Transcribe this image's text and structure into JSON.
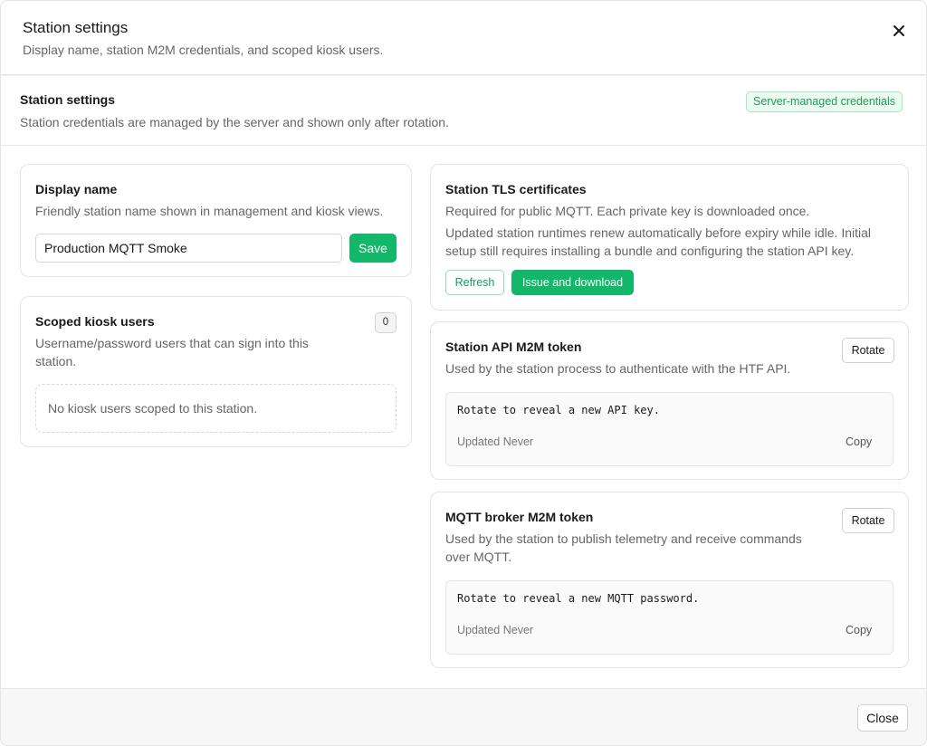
{
  "dialog": {
    "title": "Station settings",
    "subtitle": "Display name, station M2M credentials, and scoped kiosk users.",
    "close_icon": "close-icon"
  },
  "section": {
    "title": "Station settings",
    "subtitle": "Station credentials are managed by the server and shown only after rotation.",
    "badge": "Server-managed credentials"
  },
  "display_name": {
    "title": "Display name",
    "description": "Friendly station name shown in management and kiosk views.",
    "value": "Production MQTT Smoke",
    "save_label": "Save"
  },
  "kiosk_users": {
    "title": "Scoped kiosk users",
    "count": "0",
    "description_line1": "Username/password users that can sign into this",
    "description_line2": "station.",
    "empty": "No kiosk users scoped to this station."
  },
  "tls": {
    "title": "Station TLS certificates",
    "line1": "Required for public MQTT. Each private key is downloaded once.",
    "line2": "Updated station runtimes renew automatically before expiry while idle. Initial",
    "line3": "setup still requires installing a bundle and configuring the station API key.",
    "refresh_label": "Refresh",
    "issue_label": "Issue and download"
  },
  "api_token": {
    "title": "Station API M2M token",
    "description": "Used by the station process to authenticate with the HTF API.",
    "rotate_label": "Rotate",
    "placeholder": "Rotate to reveal a new API key.",
    "updated": "Updated Never",
    "copy_label": "Copy"
  },
  "mqtt_token": {
    "title": "MQTT broker M2M token",
    "description_line1": "Used by the station to publish telemetry and receive commands",
    "description_line2": "over MQTT.",
    "rotate_label": "Rotate",
    "placeholder": "Rotate to reveal a new MQTT password.",
    "updated": "Updated Never",
    "copy_label": "Copy"
  },
  "footer": {
    "close_label": "Close"
  },
  "colors": {
    "accent": "#12b76a",
    "badge_bg": "#ecfbf2",
    "badge_text": "#1f9d55"
  }
}
